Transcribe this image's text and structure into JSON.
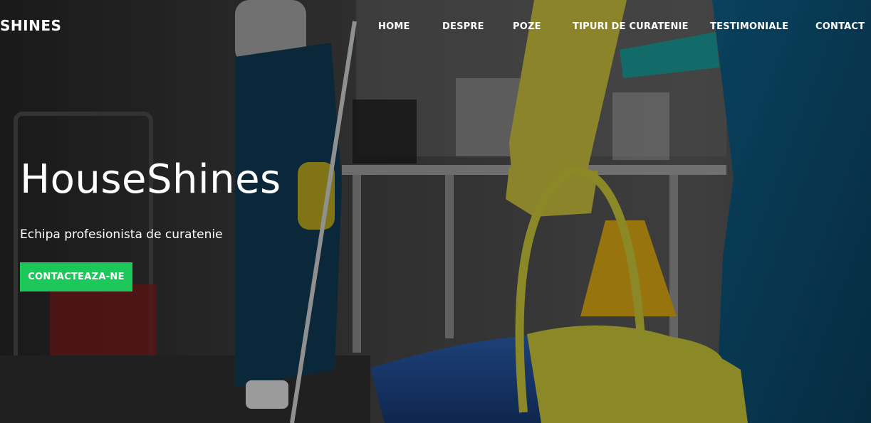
{
  "header": {
    "brand": "SHINES",
    "menu": [
      "HOME",
      "DESPRE",
      "POZE",
      "TIPURI DE CURATENIE",
      "TESTIMONIALE",
      "CONTACT"
    ]
  },
  "hero": {
    "title": "HouseShines",
    "subtitle": "Echipa profesionista de curatenie",
    "cta_label": "CONTACTEAZA-NE"
  },
  "colors": {
    "cta": "#1ec75a",
    "text": "#ffffff"
  }
}
